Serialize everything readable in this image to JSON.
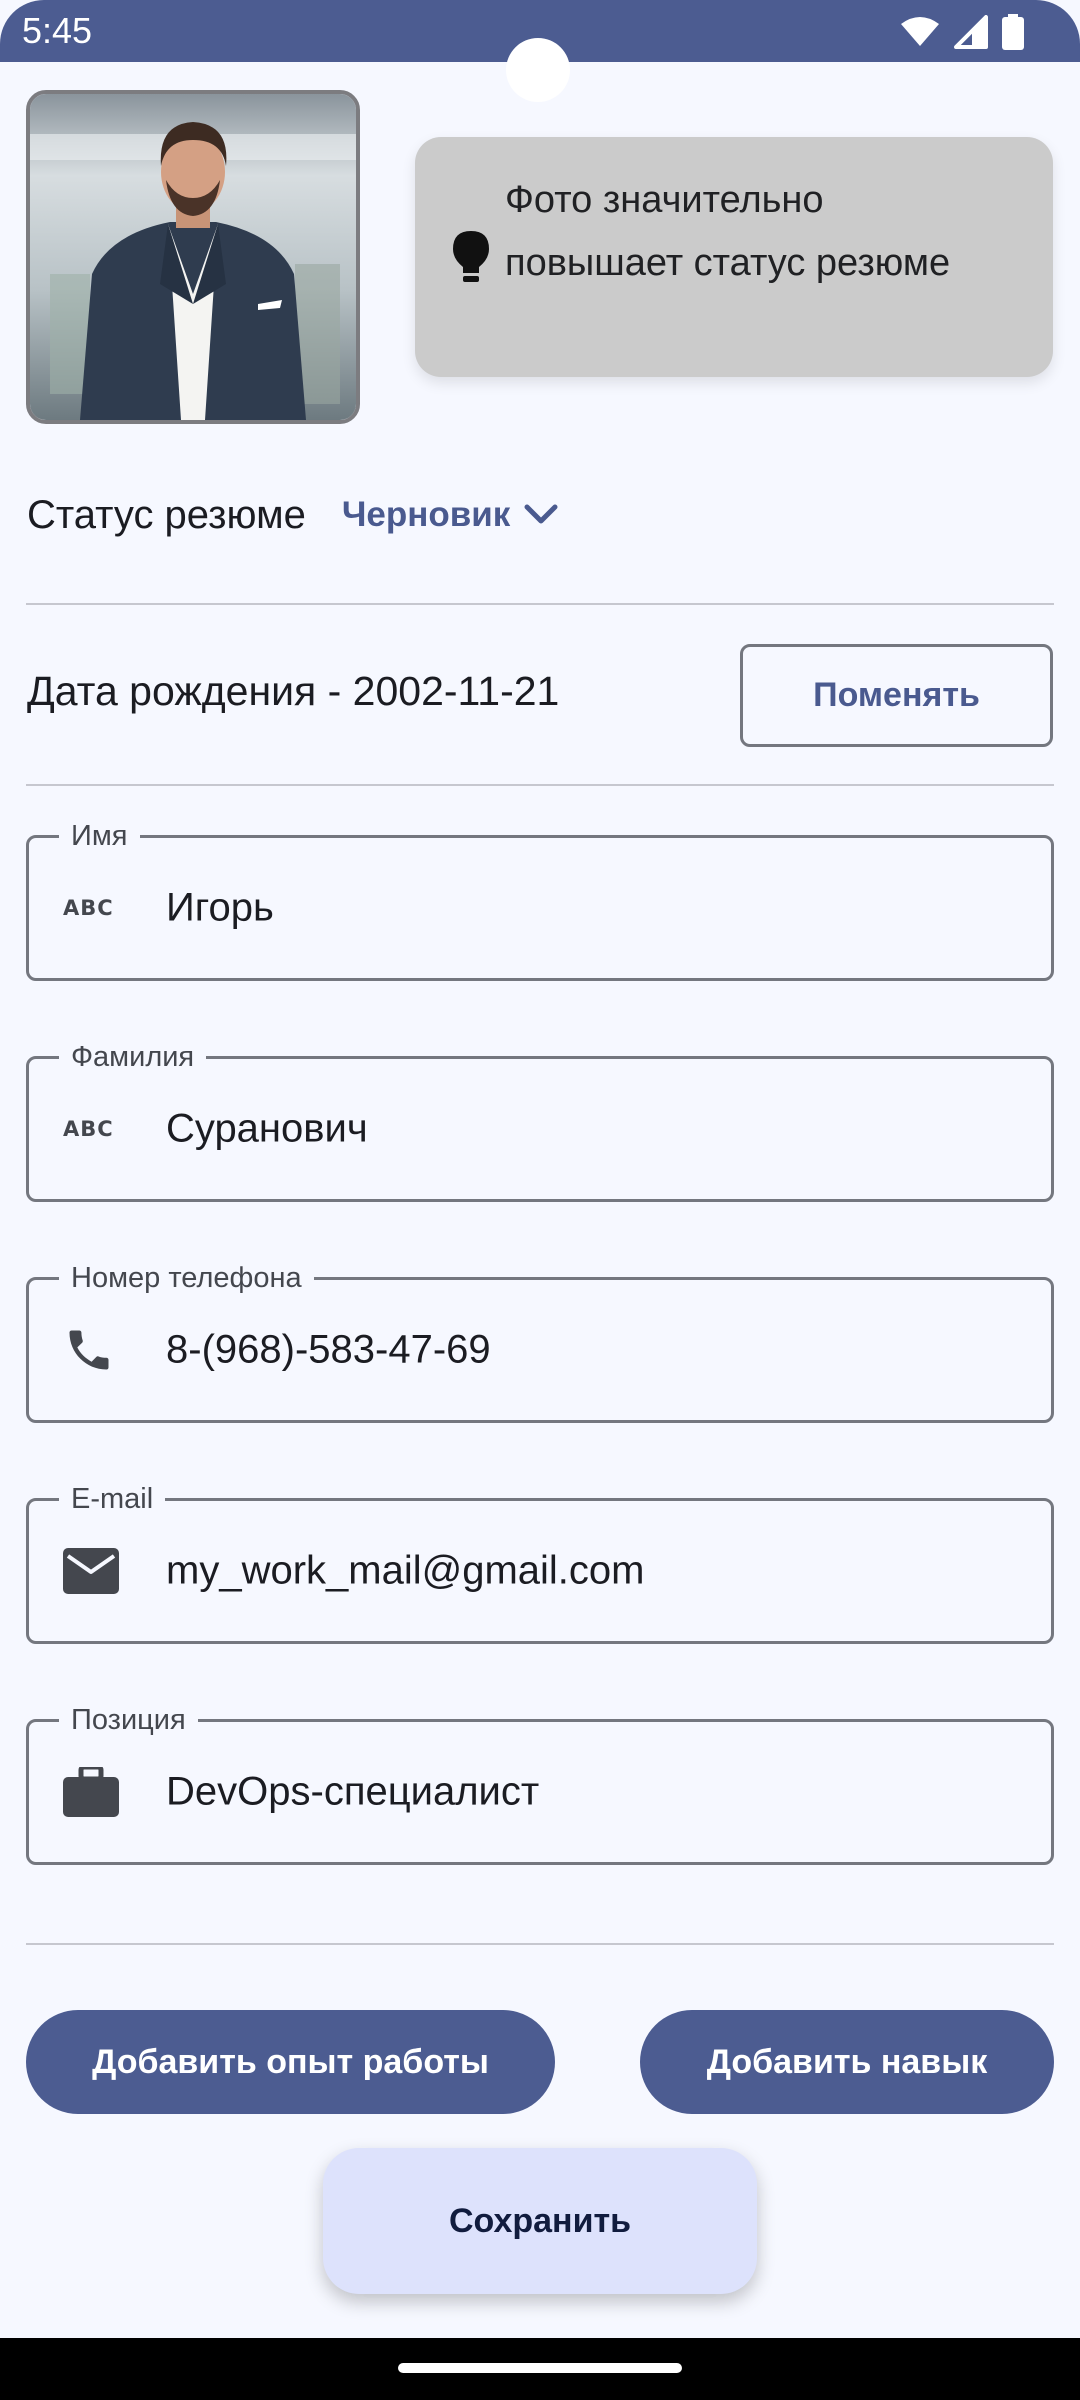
{
  "status_bar": {
    "time": "5:45"
  },
  "photo_tip": {
    "text": "Фото значительно повышает статус резюме"
  },
  "resume_status": {
    "label": "Статус резюме",
    "value": "Черновик"
  },
  "birth": {
    "text": "Дата рождения - 2002-11-21",
    "change_label": "Поменять"
  },
  "fields": {
    "first_name": {
      "label": "Имя",
      "value": "Игорь",
      "icon_text": "ABC"
    },
    "last_name": {
      "label": "Фамилия",
      "value": "Суранович",
      "icon_text": "ABC"
    },
    "phone": {
      "label": "Номер телефона",
      "value": "8-(968)-583-47-69"
    },
    "email": {
      "label": "E-mail",
      "value": "my_work_mail@gmail.com"
    },
    "position": {
      "label": "Позиция",
      "value": "DevOps-специалист"
    }
  },
  "actions": {
    "add_experience": "Добавить опыт работы",
    "add_skill": "Добавить навык",
    "save": "Сохранить"
  },
  "colors": {
    "primary": "#4c5c91",
    "background": "#f6f8ff",
    "tip_bg": "#cbcbcb",
    "save_bg": "#dde2fc"
  }
}
